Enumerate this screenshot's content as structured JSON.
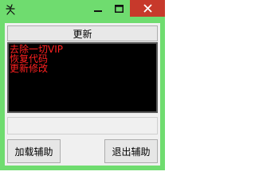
{
  "window": {
    "title": "",
    "icon": "chinese-character-icon",
    "controls": [
      "minimize-icon",
      "maximize-icon",
      "close-icon"
    ],
    "frame_color": "#6fdc6f",
    "close_color": "#c7392b"
  },
  "toolbar": {
    "update_label": "更新"
  },
  "log": {
    "lines": [
      "去除一切VIP",
      "恢复代码",
      "更新修改"
    ],
    "text_color": "#ff2020",
    "background": "#000000"
  },
  "footer": {
    "load_label": "加载辅助",
    "exit_label": "退出辅助"
  }
}
